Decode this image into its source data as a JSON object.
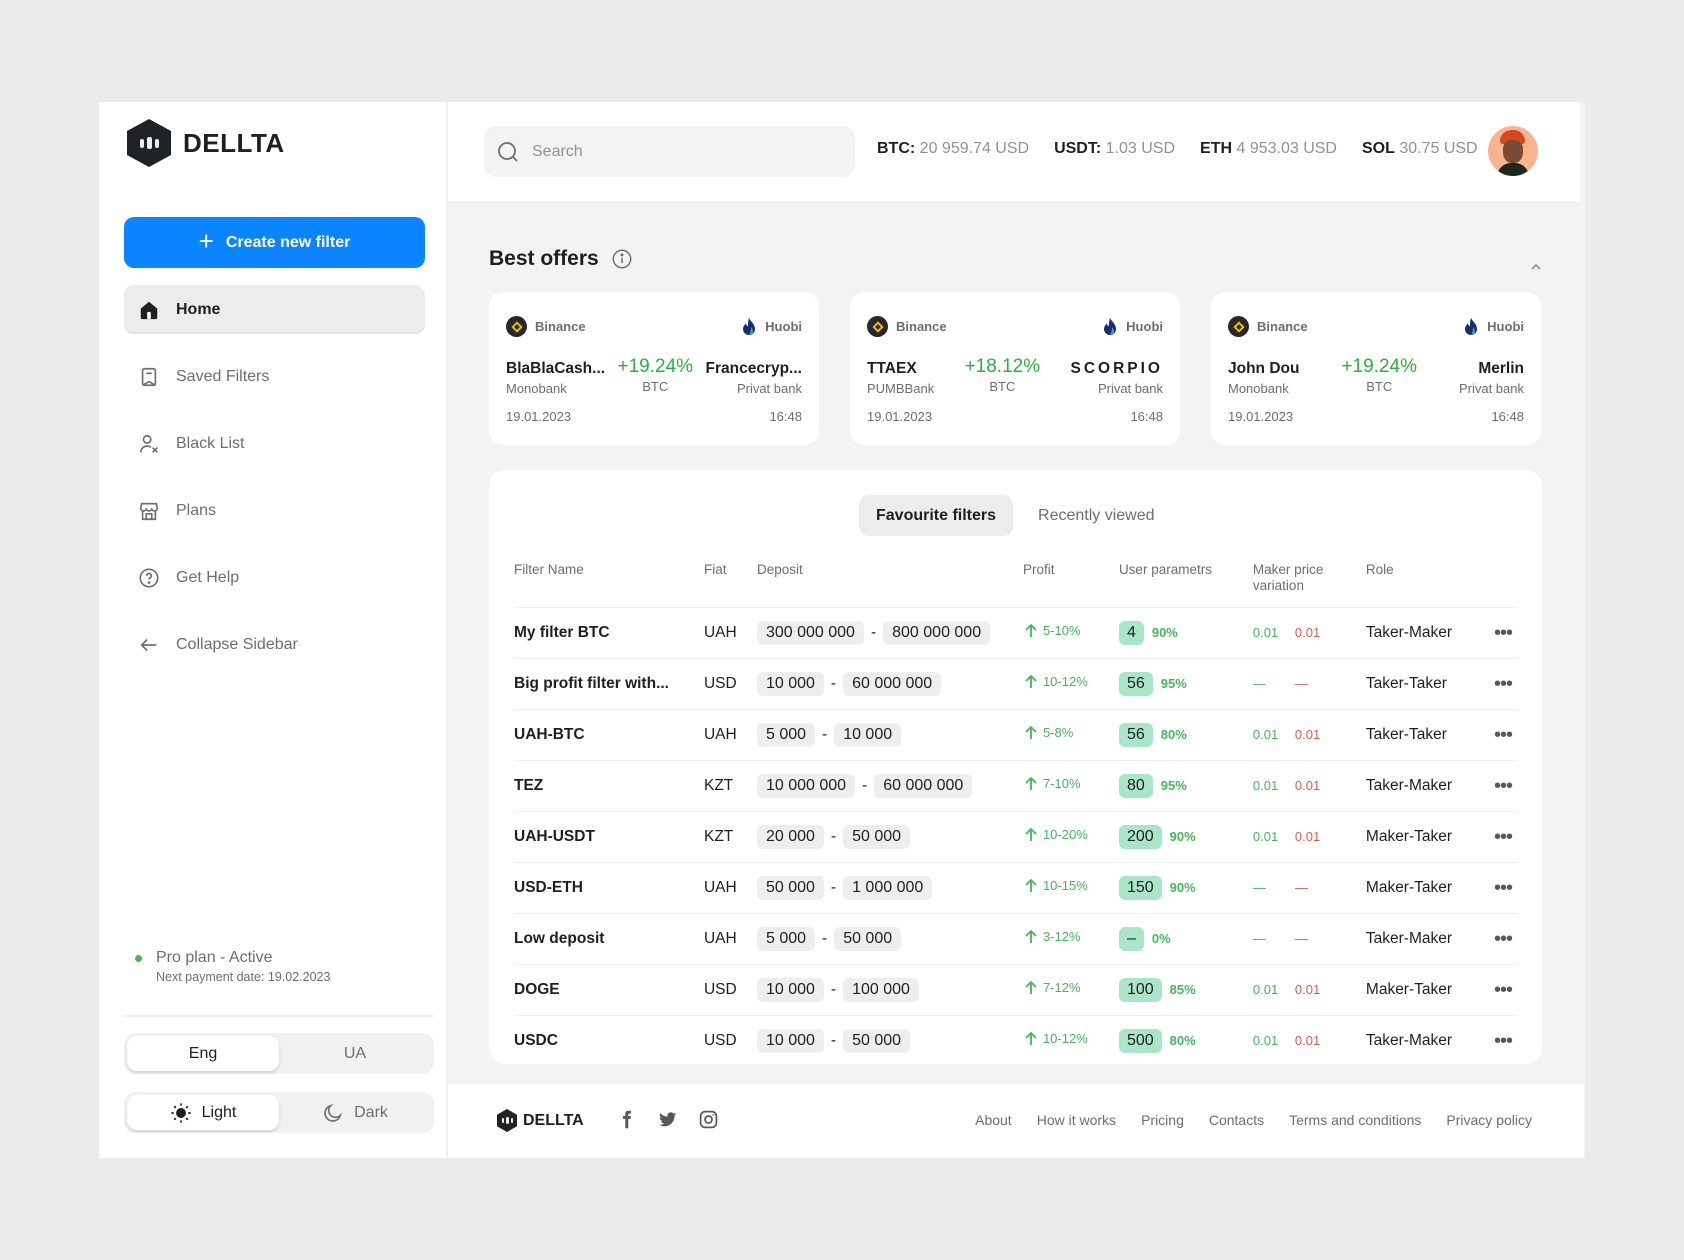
{
  "brand": {
    "name": "DELLTA"
  },
  "sidebar": {
    "create_button": "Create new filter",
    "items": [
      {
        "label": "Home",
        "icon": "home-icon",
        "active": true
      },
      {
        "label": "Saved Filters",
        "icon": "bookmark-icon"
      },
      {
        "label": "Black List",
        "icon": "user-block-icon"
      },
      {
        "label": "Plans",
        "icon": "store-icon"
      },
      {
        "label": "Get Help",
        "icon": "help-circle-icon"
      },
      {
        "label": "Collapse Sidebar",
        "icon": "arrow-left-icon"
      }
    ],
    "plan": {
      "title": "Pro plan - Active",
      "next_payment": "Next payment date: 19.02.2023",
      "status_color": "#45B65A"
    },
    "language": {
      "options": [
        "Eng",
        "UA"
      ],
      "selected": "Eng"
    },
    "theme": {
      "options": [
        "Light",
        "Dark"
      ],
      "selected": "Light"
    }
  },
  "header": {
    "search_placeholder": "Search",
    "tickers": [
      {
        "symbol": "BTC:",
        "value": "20 959.74 USD"
      },
      {
        "symbol": "USDT:",
        "value": "1.03 USD"
      },
      {
        "symbol": "ETH",
        "value": "4 953.03 USD"
      },
      {
        "symbol": "SOL",
        "value": "30.75 USD"
      }
    ]
  },
  "best_offers": {
    "title": "Best offers",
    "cards": [
      {
        "left_exchange": "Binance",
        "right_exchange": "Huobi",
        "left_name": "BlaBlaCash...",
        "left_bank": "Monobank",
        "percent": "+19.24%",
        "currency": "BTC",
        "right_name": "Francecryp...",
        "right_bank": "Privat bank",
        "date": "19.01.2023",
        "time": "16:48"
      },
      {
        "left_exchange": "Binance",
        "right_exchange": "Huobi",
        "left_name": "TTAEX",
        "left_bank": "PUMBBank",
        "percent": "+18.12%",
        "currency": "BTC",
        "right_name": "SCORPIO",
        "right_bank": "Privat bank",
        "date": "19.01.2023",
        "time": "16:48"
      },
      {
        "left_exchange": "Binance",
        "right_exchange": "Huobi",
        "left_name": "John Dou",
        "left_bank": "Monobank",
        "percent": "+19.24%",
        "currency": "BTC",
        "right_name": "Merlin",
        "right_bank": "Privat bank",
        "date": "19.01.2023",
        "time": "16:48"
      }
    ]
  },
  "filters": {
    "tabs": [
      "Favourite filters",
      "Recently viewed"
    ],
    "active_tab": "Favourite filters",
    "columns": [
      "Filter Name",
      "Fiat",
      "Deposit",
      "Profit",
      "User parametrs",
      "Maker price variation",
      "Role"
    ],
    "rows": [
      {
        "name": "My filter BTC",
        "fiat": "UAH",
        "dep_min": "300 000 000",
        "dep_max": "800 000 000",
        "profit": "5-10%",
        "user_count": "4",
        "user_pct": "90%",
        "mp_min": "0.01",
        "mp_max": "0.01",
        "role": "Taker-Maker"
      },
      {
        "name": "Big profit filter with...",
        "fiat": "USD",
        "dep_min": "10 000",
        "dep_max": "60 000 000",
        "profit": "10-12%",
        "user_count": "56",
        "user_pct": "95%",
        "mp_min": "—",
        "mp_max": "—",
        "role": "Taker-Taker"
      },
      {
        "name": "UAH-BTC",
        "fiat": "UAH",
        "dep_min": "5 000",
        "dep_max": "10 000",
        "profit": "5-8%",
        "user_count": "56",
        "user_pct": "80%",
        "mp_min": "0.01",
        "mp_max": "0.01",
        "role": "Taker-Taker"
      },
      {
        "name": "TEZ",
        "fiat": "KZT",
        "dep_min": "10 000 000",
        "dep_max": "60 000 000",
        "profit": "7-10%",
        "user_count": "80",
        "user_pct": "95%",
        "mp_min": "0.01",
        "mp_max": "0.01",
        "role": "Taker-Maker"
      },
      {
        "name": "UAH-USDT",
        "fiat": "KZT",
        "dep_min": "20 000",
        "dep_max": "50 000",
        "profit": "10-20%",
        "user_count": "200",
        "user_pct": "90%",
        "mp_min": "0.01",
        "mp_max": "0.01",
        "role": "Maker-Taker"
      },
      {
        "name": "USD-ETH",
        "fiat": "UAH",
        "dep_min": "50 000",
        "dep_max": "1 000 000",
        "profit": "10-15%",
        "user_count": "150",
        "user_pct": "90%",
        "mp_min": "—",
        "mp_max": "—",
        "role": "Maker-Taker"
      },
      {
        "name": "Low deposit",
        "fiat": "UAH",
        "dep_min": "5 000",
        "dep_max": "50 000",
        "profit": "3-12%",
        "user_count": "–",
        "user_pct": "0%",
        "mp_min": "—",
        "mp_max": "—",
        "role": "Taker-Maker"
      },
      {
        "name": "DOGE",
        "fiat": "USD",
        "dep_min": "10 000",
        "dep_max": "100 000",
        "profit": "7-12%",
        "user_count": "100",
        "user_pct": "85%",
        "mp_min": "0.01",
        "mp_max": "0.01",
        "role": "Maker-Taker"
      },
      {
        "name": "USDC",
        "fiat": "USD",
        "dep_min": "10 000",
        "dep_max": "50 000",
        "profit": "10-12%",
        "user_count": "500",
        "user_pct": "80%",
        "mp_min": "0.01",
        "mp_max": "0.01",
        "role": "Taker-Maker"
      }
    ],
    "row_more_label": "•••"
  },
  "footer": {
    "brand": "DELLTA",
    "socials": [
      "facebook-icon",
      "twitter-icon",
      "instagram-icon"
    ],
    "links": [
      "About",
      "How it works",
      "Pricing",
      "Contacts",
      "Terms and conditions",
      "Privacy policy"
    ]
  },
  "colors": {
    "accent": "#0A84FF",
    "positive": "#45B65A",
    "negative": "#E05A4A",
    "badge": "#A9E6C9"
  }
}
